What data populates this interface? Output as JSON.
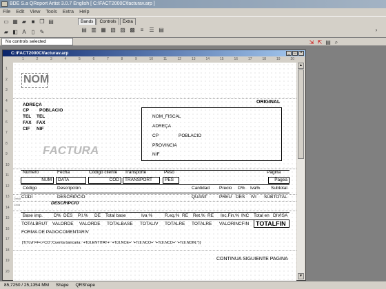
{
  "app": {
    "title": "BDE S.a QReport Artist  3.0.7 English [ C:\\FACT2000C\\facturav.arp ]"
  },
  "menu": [
    "File",
    "Edit",
    "View",
    "Tools",
    "Extra",
    "Help"
  ],
  "toolbar": {
    "tabs": [
      "Bands",
      "Controls",
      "Extra"
    ],
    "active_tab": "Bands"
  },
  "selection": {
    "label": "No controls selected"
  },
  "child_window": {
    "title": "C:\\FACT2000C\\facturav.arp"
  },
  "rulers": {
    "top": [
      "1",
      "2",
      "3",
      "4",
      "5",
      "6",
      "7",
      "8",
      "9",
      "10",
      "11",
      "12",
      "13",
      "14",
      "15",
      "16",
      "17",
      "18",
      "19",
      "20"
    ],
    "left": [
      "1",
      "2",
      "3",
      "4",
      "5",
      "6",
      "7",
      "8",
      "9",
      "10",
      "11",
      "12",
      "13",
      "14",
      "15",
      "16",
      "17",
      "18",
      "19",
      "20"
    ]
  },
  "report": {
    "nom": "NOM",
    "original": "ORIGINAL",
    "factura": "FACTURA",
    "left_labels": [
      "ADREÇA",
      "CP",
      "POBLACIO",
      "TEL",
      "TEL",
      "FAX",
      "FAX",
      "CIF",
      "NIF"
    ],
    "address_box": [
      "NOM_FISCAL",
      "ADREÇA",
      "CP",
      "POBLACIO",
      "PROVINCIA",
      "NIF"
    ],
    "header_row1": [
      "Número",
      "Fecha",
      "Código cliente",
      "Transporte",
      "Peso",
      "Página"
    ],
    "header_row1_values": [
      "NUM",
      "DATA",
      "COD",
      "TRANSPORT",
      "PES",
      "Pagea"
    ],
    "header_row2": [
      "Código",
      "Descripción",
      "Cantidad",
      "Precio",
      "D%",
      "Iva%",
      "Subtotal"
    ],
    "detail_values": [
      "CODI",
      "DESCRIPCIO",
      "QUANT",
      "PREU",
      "DES",
      "IVI",
      "SUBTOTAL"
    ],
    "band_labels": [
      "Detail",
      "Child"
    ],
    "child_desc": "DESCRIPCIO",
    "totals_headers": [
      "Base imp.",
      "D%",
      "DES",
      "P.I.%",
      "DE",
      "Total base",
      "Iva %",
      "R.eq.%",
      "RE",
      "Ret.%",
      "RE",
      "Inc.Fin.%",
      "INC",
      "Total en",
      "DIVISA"
    ],
    "totals_values": [
      "TOTALBRUT",
      "VALORDE",
      "VALORDE",
      "TOTALBASE",
      "TOTALIV",
      "TOTALRE",
      "TOTALRE",
      "VALORINCFIN",
      "TOTALFIN"
    ],
    "forma_pago": "FORMA DE PAGO:",
    "comentariv": "COMENTARIV",
    "expr": "[T(Tcvf FF<>'CO';'Cuenta bancaria: '+Tctl.ENTITAT+'  '+Tctl.NCE+'  '+Tctl.NCO+'  '+Tctl.NCD+'  '+Tctl.NDIN;'')]",
    "continua": "CONTINUA SIGUIENTE PAGINA"
  },
  "status": {
    "coords": "85,7250 / 25,1354 MM",
    "mode": "Shape",
    "object": "QRShape"
  }
}
